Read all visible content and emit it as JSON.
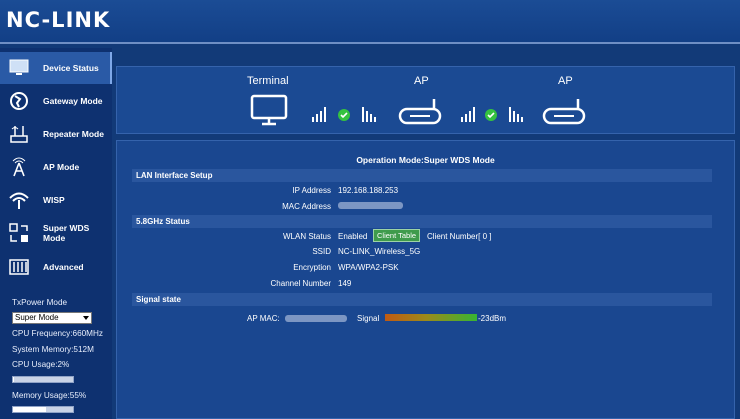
{
  "header": {
    "logo": "NC-LINK"
  },
  "sidebar": {
    "items": [
      {
        "label": "Device Status",
        "icon": "monitor-icon"
      },
      {
        "label": "Gateway Mode",
        "icon": "globe-icon"
      },
      {
        "label": "Repeater Mode",
        "icon": "repeater-icon"
      },
      {
        "label": "AP Mode",
        "icon": "ap-antenna-icon"
      },
      {
        "label": "WISP",
        "icon": "wifi-icon"
      },
      {
        "label": "Super WDS Mode",
        "icon": "wds-icon"
      },
      {
        "label": "Advanced",
        "icon": "sliders-icon"
      }
    ],
    "txpower_label": "TxPower Mode",
    "txpower_value": "Super Mode",
    "cpu_frequency": "CPU Frequency:660MHz",
    "system_memory": "System Memory:512M",
    "cpu_usage_label": "CPU Usage:2%",
    "cpu_usage_percent": 2,
    "memory_usage_label": "Memory Usage:55%",
    "memory_usage_percent": 55
  },
  "topology": {
    "nodes": [
      "Terminal",
      "AP",
      "AP"
    ],
    "link_status": [
      "connected",
      "connected"
    ]
  },
  "main": {
    "operation_mode": "Operation Mode:Super WDS Mode",
    "lan": {
      "title": "LAN Interface Setup",
      "ip_label": "IP Address",
      "ip_value": "192.168.188.253",
      "mac_label": "MAC Address"
    },
    "wlan": {
      "title": "5.8GHz Status",
      "status_label": "WLAN Status",
      "status_value": "Enabled",
      "client_table_button": "Client Table",
      "client_number": "Client Number[ 0 ]",
      "ssid_label": "SSID",
      "ssid_value": "NC-LINK_Wireless_5G",
      "encryption_label": "Encryption",
      "encryption_value": "WPA/WPA2-PSK",
      "channel_label": "Channel Number",
      "channel_value": "149"
    },
    "signal": {
      "title": "Signal state",
      "ap_mac_label": "AP MAC:",
      "signal_label": "Signal",
      "signal_value": "-23dBm"
    }
  },
  "colors": {
    "background": "#123a78",
    "panel": "#1a4790",
    "accent_green": "#3f9b4c"
  }
}
